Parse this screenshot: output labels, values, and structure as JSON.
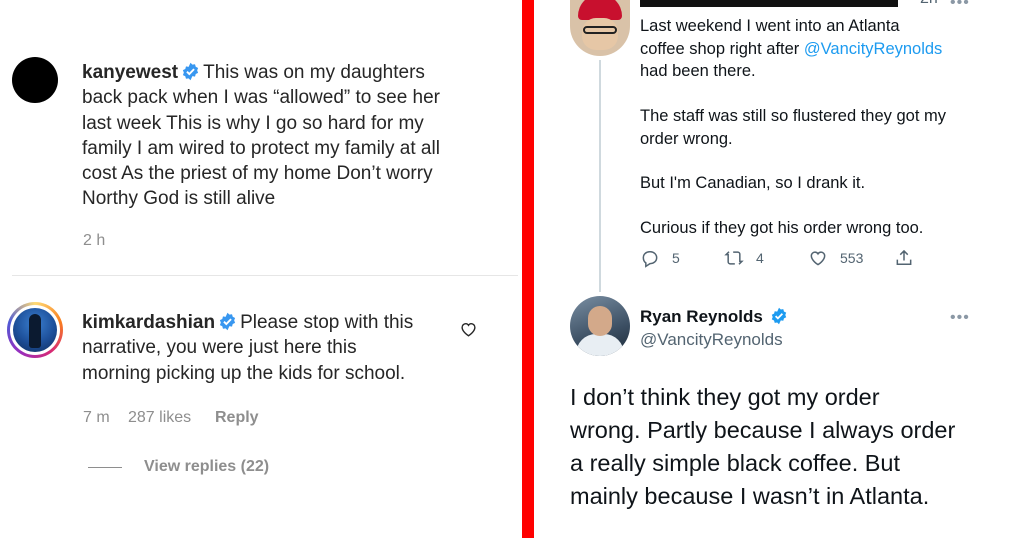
{
  "left": {
    "comment1": {
      "username": "kanyewest",
      "lines": [
        "This was on my daughters",
        "back pack when I was “allowed” to see her",
        "last week This is why I go so hard for my",
        "family I am wired to protect my family at all",
        "cost As the priest of my home Don’t worry",
        "Northy God is still alive"
      ],
      "time": "2 h"
    },
    "comment2": {
      "username": "kimkardashian",
      "lines": [
        "Please stop with this",
        "narrative, you were just here this",
        "morning picking up the kids for school."
      ],
      "time": "7 m",
      "likes": "287 likes",
      "reply_label": "Reply",
      "view_replies": "View replies (22)"
    }
  },
  "right": {
    "tweet1": {
      "time": "2h",
      "line1": "Last weekend I went into an Atlanta",
      "line2_prefix": "coffee shop right after ",
      "mention": "@VancityReynolds",
      "line3": "had been there.",
      "para2_l1": "The staff was still so flustered they got my",
      "para2_l2": "order wrong.",
      "para3": "But I'm Canadian, so I drank it.",
      "para4": "Curious if they got his order wrong too.",
      "replies": "5",
      "retweets": "4",
      "likes": "553"
    },
    "tweet2": {
      "name": "Ryan Reynolds",
      "handle": "@VancityReynolds",
      "lines": [
        "I don’t think they got my order",
        "wrong. Partly because I always order",
        "a really simple black coffee. But",
        "mainly because I wasn’t in Atlanta."
      ]
    }
  },
  "colors": {
    "divider": "#ff0000",
    "verified": "#3897f0",
    "twitter_blue": "#1d9bf0",
    "twitter_verified": "#1d9bf0"
  },
  "icons": [
    "verified-badge-icon",
    "heart-icon",
    "reply-icon",
    "retweet-icon",
    "like-icon",
    "share-icon",
    "more-icon"
  ]
}
